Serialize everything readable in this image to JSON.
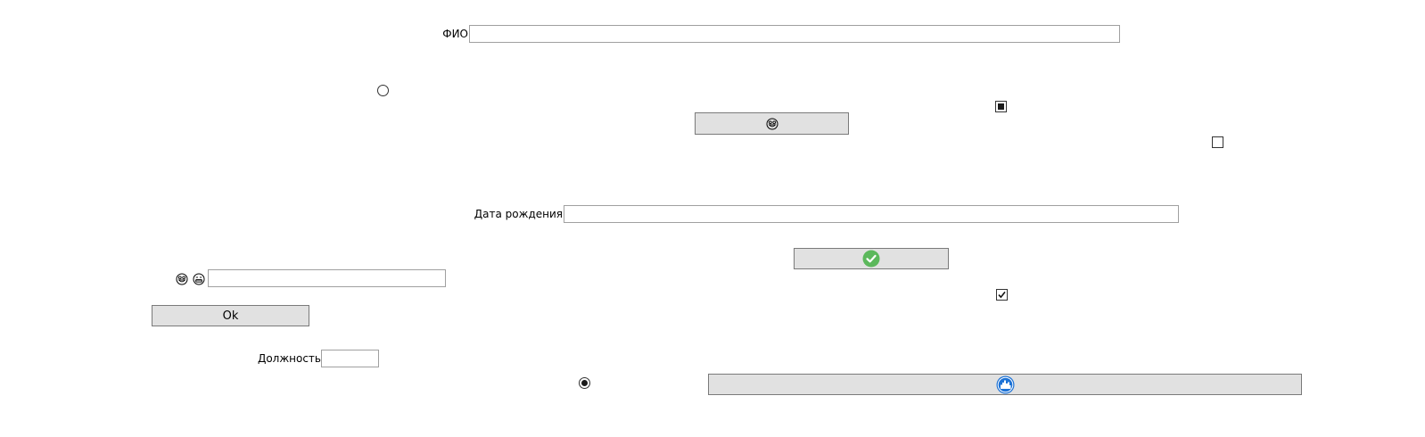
{
  "form": {
    "fio_label": "ФИО",
    "fio_value": "",
    "birthdate_label": "Дата рождения",
    "birthdate_value": "",
    "position_label": "Должность",
    "position_value": "",
    "emoji_field_value": "",
    "ok_button_label": "Ok"
  },
  "controls": {
    "radio_top_checked": false,
    "radio_bottom_checked": true,
    "checkbox_top_state": "indeterminate",
    "checkbox_mid_state": "unchecked",
    "checkbox_low_state": "checked"
  },
  "icons": {
    "emoji_button_icon": "grinning-face-icon",
    "check_button_icon": "green-check-icon",
    "blue_button_icon": "blue-city-icon",
    "emoji_label_icons": [
      "grinning-face-icon",
      "smiling-face-icon"
    ]
  },
  "colors": {
    "button_bg": "#e1e1e1",
    "button_border": "#7a7a7a",
    "input_border": "#a0a0a0",
    "check_green": "#5cb85c",
    "icon_blue": "#1e73d6"
  }
}
